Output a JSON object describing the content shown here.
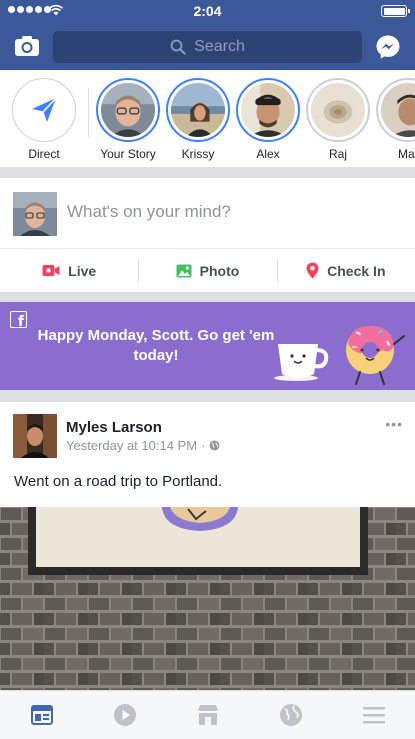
{
  "status_bar": {
    "time": "2:04"
  },
  "nav": {
    "search_placeholder": "Search"
  },
  "stories": [
    {
      "label": "Direct"
    },
    {
      "label": "Your Story"
    },
    {
      "label": "Krissy"
    },
    {
      "label": "Alex"
    },
    {
      "label": "Raj"
    },
    {
      "label": "Mat"
    }
  ],
  "composer": {
    "placeholder": "What's on your mind?",
    "actions": [
      {
        "label": "Live",
        "icon": "live-video-icon",
        "color": "#f3425f"
      },
      {
        "label": "Photo",
        "icon": "photo-icon",
        "color": "#45bd62"
      },
      {
        "label": "Check In",
        "icon": "location-pin-icon",
        "color": "#f3425f"
      }
    ]
  },
  "banner": {
    "message": "Happy Monday, Scott. Go get 'em today!",
    "color": "#8a6dcc"
  },
  "post": {
    "author": "Myles Larson",
    "timestamp": "Yesterday at 10:14 PM",
    "separator": "·",
    "text": "Went on a road trip to Portland."
  },
  "tabs": [
    {
      "icon": "news-feed-icon",
      "active": true
    },
    {
      "icon": "video-play-icon",
      "active": false
    },
    {
      "icon": "marketplace-icon",
      "active": false
    },
    {
      "icon": "globe-icon",
      "active": false
    },
    {
      "icon": "menu-icon",
      "active": false
    }
  ],
  "colors": {
    "brand": "#3b5998",
    "active_tab": "#4267b2",
    "inactive_tab": "#bec2c9"
  }
}
